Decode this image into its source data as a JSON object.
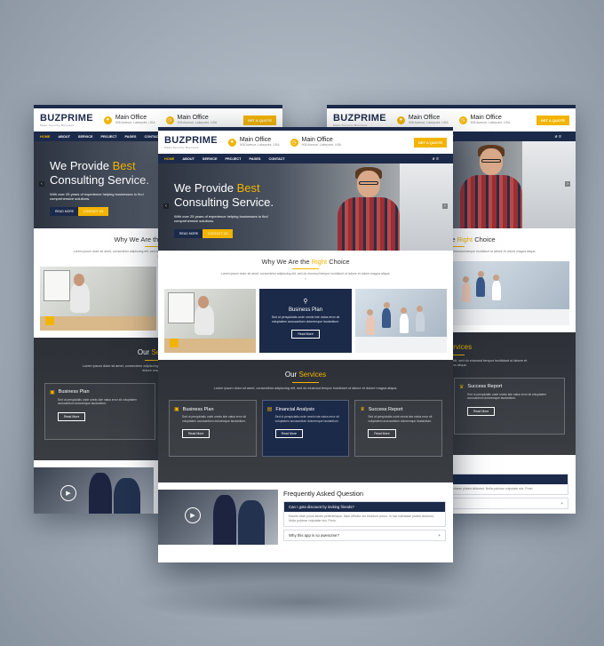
{
  "brand": {
    "logo": "BUZPRIME",
    "tagline": "Make Security Business"
  },
  "header": {
    "office1_title": "Main Office",
    "office1_addr": "908 Avenue, Lakepoint, USA",
    "office2_title": "Main Office",
    "office2_addr": "908 Avenue, Lakepoint, USA",
    "quote_label": "GET A QUOTE"
  },
  "nav": [
    "HOME",
    "ABOUT",
    "SERVICE",
    "PROJECT",
    "PAGES",
    "CONTACT"
  ],
  "hero": {
    "line1_prefix": "We Provide ",
    "line1_highlight": "Best",
    "line2": "Consulting Service.",
    "desc": "With over 25 years of experience helping businesses to find comprehensive solutions.",
    "btn_read": "READ MORE",
    "btn_contact": "CONTACT US"
  },
  "why": {
    "title_prefix": "Why We Are the ",
    "title_highlight": "Right",
    "title_suffix": " Choice",
    "desc": "Lorem ipsum dolor sit amet, consectetur adipiscing elit, sed do eiusmod tempor incididunt ut labore et dolore magna aliqua."
  },
  "plan_tile": {
    "title": "Business Plan",
    "desc": "Sed ut perspiciatis unde omnis iste natus error sit voluptatem accusantium doloremque laudantium.",
    "btn": "Read More"
  },
  "services": {
    "title_prefix": "Our ",
    "title_highlight": "Services",
    "desc": "Lorem ipsum dolor sit amet, consectetur adipiscing elit, sed do eiusmod tempor incididunt ut labore et dolore magna aliqua.",
    "cards": [
      {
        "title": "Business Plan",
        "desc": "Sed ut perspiciatis unde omnis iste natus error sit voluptatem accusantium doloremque laudantium.",
        "btn": "Read More"
      },
      {
        "title": "Financial Analysis",
        "desc": "Sed ut perspiciatis unde omnis iste natus error sit voluptatem accusantium doloremque laudantium.",
        "btn": "Read More"
      },
      {
        "title": "Success Report",
        "desc": "Sed ut perspiciatis unde omnis iste natus error sit voluptatem accusantium doloremque laudantium.",
        "btn": "Read More"
      }
    ]
  },
  "faq": {
    "title": "Frequently Asked Question",
    "q1": "Can I gota discount by inviting friends?",
    "a1": "Mauris vitae purus fames pellentesque. Nam efficitur dui tincidunt purus. In hac habitasse platea dictumst. Nulla pulvinar vulputate nisi. Proin.",
    "q2": "Why this app is so awesome?",
    "plus": "+"
  },
  "colors": {
    "navy": "#1c2a4a",
    "accent": "#f3b400"
  }
}
